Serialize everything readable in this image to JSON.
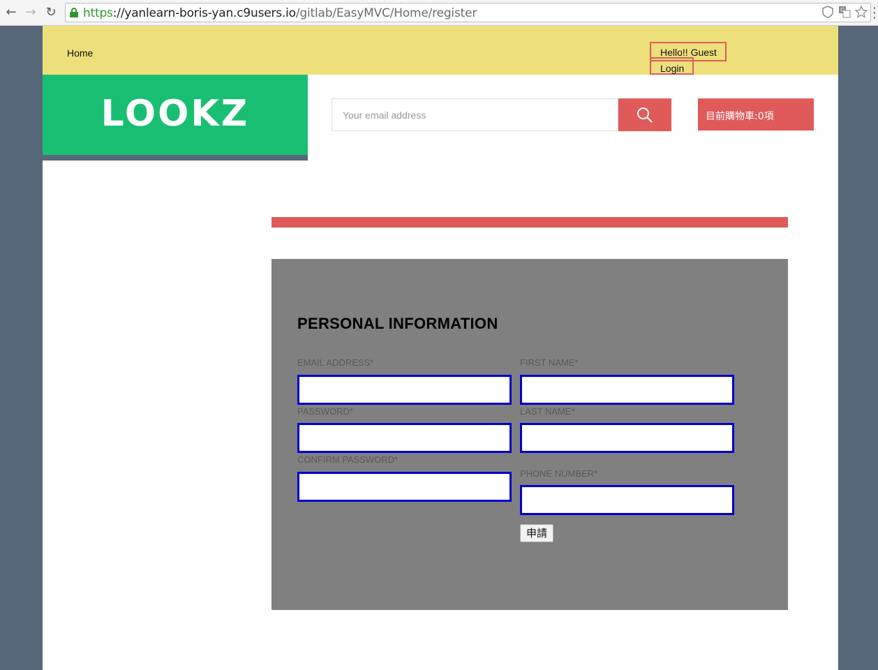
{
  "browser": {
    "url_scheme": "https",
    "url_host": "://yanlearn-boris-yan.c9users.io",
    "url_path": "/gitlab/EasyMVC/Home/register",
    "back_glyph": "←",
    "forward_glyph": "→",
    "reload_glyph": "↻",
    "icons": [
      "shield-icon",
      "translate-icon",
      "star-icon"
    ]
  },
  "topbar": {
    "home_label": "Home",
    "greeting": "Hello!! Guest",
    "login_label": "Login"
  },
  "header": {
    "logo_text": "LOOKZ",
    "search_placeholder": "Your email address",
    "cart_label": "目前購物車:0項"
  },
  "form": {
    "title": "PERSONAL INFORMATION",
    "email_label": "EMAIL ADDRESS*",
    "first_name_label": "FIRST NAME*",
    "password_label": "PASSWORD*",
    "last_name_label": "LAST NAME*",
    "confirm_password_label": "CONFIRM PASSWORD*",
    "phone_label": "PHONE NUMBER*",
    "submit_label": "申請"
  },
  "colors": {
    "topbar": "#ede07b",
    "logo": "#18bf73",
    "accent": "#e05a5a",
    "panel": "#808080",
    "input_border": "#0000cc",
    "backdrop": "#566779"
  }
}
